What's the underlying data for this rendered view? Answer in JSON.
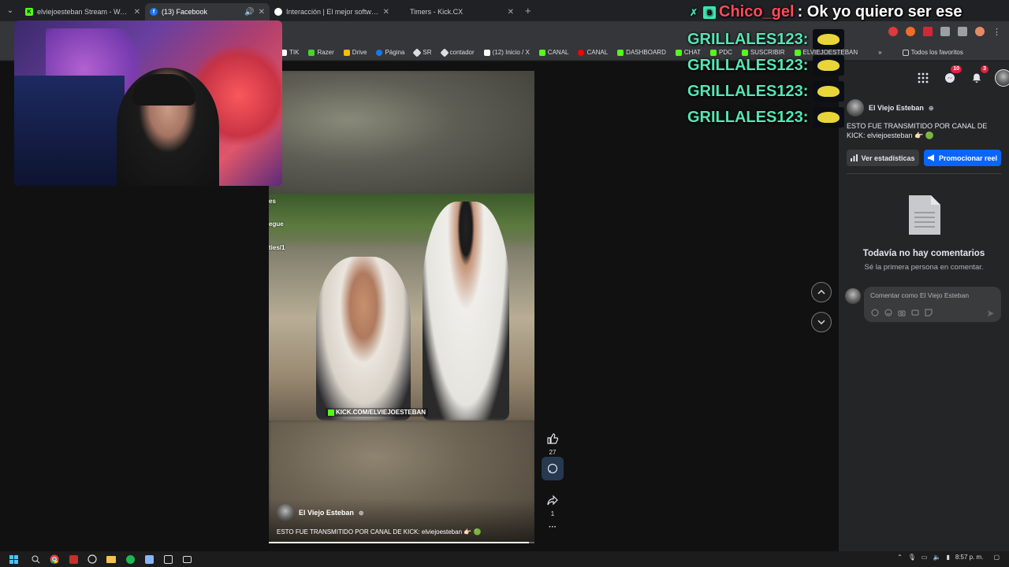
{
  "browser": {
    "tabs": [
      {
        "title": "elviejoesteban Stream - Watch",
        "favicon": "kick-icon",
        "color": "#53fc18",
        "active": false
      },
      {
        "title": "(13) Facebook",
        "favicon": "facebook-icon",
        "color": "#1877f2",
        "active": true
      },
      {
        "title": "Interacción | El mejor software",
        "favicon": "app-icon",
        "color": "#ffffff",
        "active": false
      },
      {
        "title": "Timers - Kick.CX",
        "favicon": "",
        "color": "",
        "active": false
      }
    ],
    "new_tab": "+",
    "bookmarks": [
      {
        "label": "TIK",
        "color": "#ffffff"
      },
      {
        "label": "Razer",
        "color": "#44d62c"
      },
      {
        "label": "Drive",
        "color": "#fbbc04"
      },
      {
        "label": "Página",
        "color": "#1877f2"
      },
      {
        "label": "SR",
        "color": "#dddddd"
      },
      {
        "label": "contador",
        "color": "#dddddd"
      },
      {
        "label": "(12) Inicio / X",
        "color": "#ffffff"
      },
      {
        "label": "CANAL",
        "color": "#53fc18"
      },
      {
        "label": "CANAL",
        "color": "#ff0000"
      },
      {
        "label": "DASHBOARD",
        "color": "#53fc18"
      },
      {
        "label": "CHAT",
        "color": "#53fc18"
      },
      {
        "label": "PDC",
        "color": "#53fc18"
      },
      {
        "label": "SUSCRIBIR",
        "color": "#53fc18"
      },
      {
        "label": "ELVIEJOESTEBAN",
        "color": "#53fc18"
      }
    ],
    "bookmarks_more": "»",
    "all_favorites": "Todos los favoritos"
  },
  "chat": {
    "top_message": {
      "user": "Chico_gel",
      "text": ": Ok yo quiero ser ese"
    },
    "lines": [
      {
        "text": "GRILLALES123:"
      },
      {
        "text": "GRILLALES123:"
      },
      {
        "text": "GRILLALES123:"
      },
      {
        "text": "GRILLALES123:"
      }
    ]
  },
  "reel": {
    "overlay_text": [
      "es",
      "egue",
      "ties/1"
    ],
    "watermark": "KICK.COM/ELVIEJOESTEBAN",
    "author": "El Viejo Esteban",
    "caption": "ESTO FUE TRANSMITIDO POR CANAL DE KICK: elviejoesteban 👉🏻 🟢",
    "progress": 0.98,
    "likes": "27",
    "shares": "1",
    "more": "···"
  },
  "side": {
    "notif_messenger": "10",
    "notif_bell": "3",
    "author": "El Viejo Esteban",
    "description": "ESTO FUE TRANSMITIDO POR CANAL DE KICK: elviejoesteban 👉🏻 🟢",
    "stats_button": "Ver estadísticas",
    "promote_button": "Promocionar reel",
    "no_comments_title": "Todavía no hay comentarios",
    "no_comments_sub": "Sé la primera persona en comentar.",
    "comment_placeholder": "Comentar como El Viejo Esteban"
  },
  "taskbar": {
    "time": "8:57 p. m."
  }
}
